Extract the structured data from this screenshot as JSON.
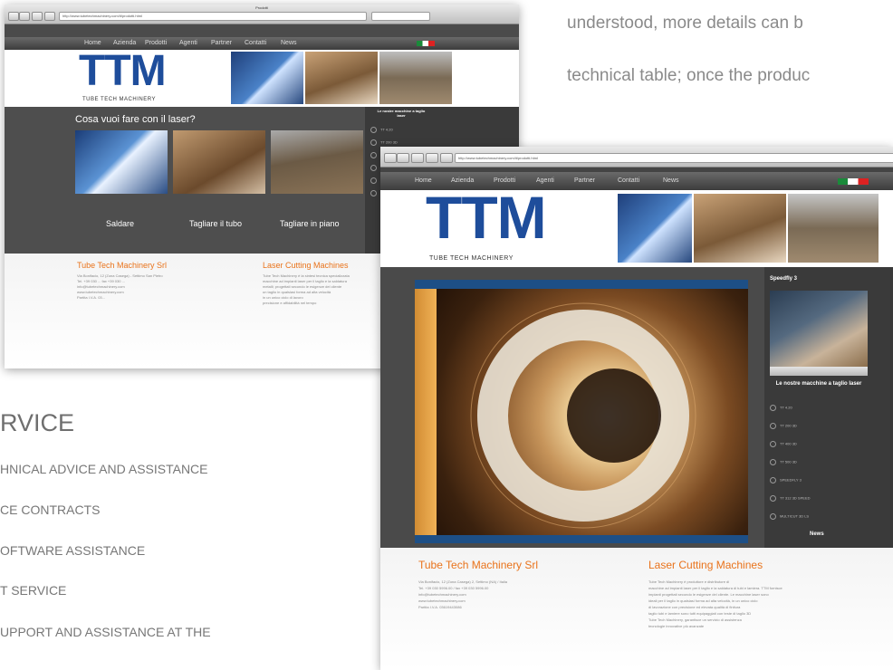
{
  "intro": {
    "line1": "understood, more details can b",
    "line2": "technical table; once the produc"
  },
  "service": {
    "title": "RVICE",
    "items": [
      "HNICAL ADVICE AND ASSISTANCE",
      "CE CONTRACTS",
      "OFTWARE ASSISTANCE",
      "T SERVICE",
      "UPPORT AND ASSISTANCE AT THE"
    ]
  },
  "back_window": {
    "title": "Prodotti",
    "url": "http://www.tubetechmachinery.com/it/prodotti.html",
    "nav": [
      "Home",
      "Azienda",
      "Prodotti",
      "Agenti",
      "Partner",
      "Contatti",
      "News"
    ],
    "logo": "TTM",
    "logo_sub": "TUBE TECH MACHINERY",
    "headline": "Cosa vuoi fare con il laser?",
    "options": [
      "Saldare",
      "Tagliare il tubo",
      "Tagliare in piano"
    ],
    "sidebar_title": "Le nostre macchine a taglio laser",
    "sidebar_items": [
      "TT 4.20",
      "TT 200 3D",
      "",
      "",
      "",
      "",
      ""
    ],
    "footer": {
      "col1_title": "Tube Tech Machinery Srl",
      "col1_lines": [
        "Via Bonifacio, 12 (Zona Casega) - Settimo San Pietro",
        "Tel. +39 030 ... fax +39 030 ...",
        "info@tubetechmachinery.com",
        "www.tubetechmachinery.com",
        "Partita I.V.A. 03..."
      ],
      "col2_title": "Laser Cutting Machines",
      "col2_lines": [
        "Tube Tech Machinery è la sintesi tecnica specializzata",
        "macchine ad impianti laser per il taglio e la saldatura",
        "metalli; progettati secondo le esigenze del cliente",
        "un taglio in qualsiasi forma ad alta velocità",
        "in un unico ciclo di lavoro",
        "precisione e affidabilità nel tempo"
      ]
    }
  },
  "front_window": {
    "url": "http://www.tubetechmachinery.com/it/prodotti.html",
    "nav": [
      "Home",
      "Azienda",
      "Prodotti",
      "Agenti",
      "Partner",
      "Contatti",
      "News"
    ],
    "logo": "TTM",
    "logo_sub": "TUBE TECH MACHINERY",
    "sidebar_title": "Speedfly 3",
    "sidebar_title2": "Le nostre macchine a taglio laser",
    "sidebar_items": [
      "TT 4.20",
      "TT 200 3D",
      "TT 400 3D",
      "TT 500 3D",
      "SPEEDFLY 3",
      "TT 312 3D SPEED",
      "MULTICUT 3D LS"
    ],
    "sidebar_more": "News",
    "footer": {
      "col1_title": "Tube Tech Machinery Srl",
      "col1_lines": [
        "Via Bonifacio, 12 (Zona Casega) 2, Settimo (NA) / Italia",
        "Tel. +39 030 5996.00 / fax +39 030 5996.00",
        "info@tubetechmachinery.com",
        "www.tubetechmachinery.com",
        "Partita I.V.A. 03619443086"
      ],
      "col2_title": "Laser Cutting Machines",
      "col2_lines": [
        "Tube Tech Machinery è produttore e distributore di",
        "macchine ad impianti laser per il taglio e la saldatura di tubi e lamiera. TTM fornisce",
        "impianti progettati secondo le esigenze del cliente. Le macchine laser sono",
        "ideali per il taglio in qualsiasi forma ad alta velocità, in un unico ciclo",
        "di lavorazione con precisione ed elevata qualità di finitura",
        "taglio tubi e lamiere sono tutti equipaggiati con teste di taglio 3D",
        "Tube Tech Machinery, garantisce un servizio di assistenza",
        "tecnologie innovative più avanzate"
      ]
    }
  },
  "colors": {
    "accent": "#e9731b",
    "logo_blue": "#1e4d9b",
    "dark_bg": "#4b4b4b"
  }
}
